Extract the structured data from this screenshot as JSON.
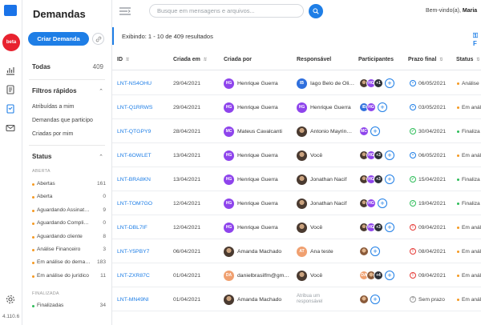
{
  "app": {
    "version": "4.110.6",
    "workspace_badge": "beta"
  },
  "sidebar": {
    "title": "Demandas",
    "create_button": "Criar Demanda",
    "all": {
      "label": "Todas",
      "count": "409"
    },
    "quick_filters": {
      "title": "Filtros rápidos",
      "items": [
        "Atribuídas a mim",
        "Demandas que participo",
        "Criadas por mim"
      ]
    },
    "status": {
      "title": "Status",
      "group_open": "ABERTA",
      "open_items": [
        {
          "label": "Abertas",
          "count": "161",
          "color": "#f59a23"
        },
        {
          "label": "Aberta",
          "count": "0",
          "color": "#f59a23"
        },
        {
          "label": "Aguardando Assinat…",
          "count": "9",
          "color": "#f59a23"
        },
        {
          "label": "Aguardando Compli…",
          "count": "0",
          "color": "#f59a23"
        },
        {
          "label": "Aguardando cliente",
          "count": "8",
          "color": "#f59a23"
        },
        {
          "label": "Análise Financeiro",
          "count": "3",
          "color": "#f59a23"
        },
        {
          "label": "Em análise do dema…",
          "count": "183",
          "color": "#f59a23"
        },
        {
          "label": "Em análise do jurídico",
          "count": "11",
          "color": "#f59a23"
        }
      ],
      "group_closed": "FINALIZADA",
      "closed_items": [
        {
          "label": "Finalizadas",
          "count": "34",
          "color": "#2ebd59"
        }
      ]
    }
  },
  "topbar": {
    "search_placeholder": "Busque em mensagens e arquivos...",
    "welcome_prefix": "Bem-vindo(a), ",
    "user_name": "Maria"
  },
  "results": {
    "text": "Exibindo: 1 - 10 de 409 resultados",
    "filter_label": "F"
  },
  "table": {
    "headers": {
      "id": "ID",
      "created_at": "Criada em",
      "created_by": "Criada por",
      "responsible": "Responsável",
      "participants": "Participantes",
      "deadline": "Prazo final",
      "status": "Status"
    },
    "rows": [
      {
        "id": "LNT-NS4OHU",
        "created": "29/04/2021",
        "by": {
          "initials": "HG",
          "name": "Henrique Guerra",
          "color": "#8e44ec"
        },
        "resp": {
          "initials": "IB",
          "name": "Iago Belo de Oli…",
          "color": "#2f6fdd"
        },
        "parts": [
          {
            "t": "photo"
          },
          {
            "t": "ini",
            "initials": "HG",
            "color": "#8e44ec"
          }
        ],
        "more": "+1",
        "deadline": {
          "text": "06/05/2021",
          "kind": "clock"
        },
        "status": {
          "text": "Análise",
          "color": "#f59a23"
        }
      },
      {
        "id": "LNT-Q1RRWS",
        "created": "29/04/2021",
        "by": {
          "initials": "HG",
          "name": "Henrique Guerra",
          "color": "#8e44ec"
        },
        "resp": {
          "initials": "HG",
          "name": "Henrique Guerra",
          "color": "#8e44ec"
        },
        "parts": [
          {
            "t": "ini",
            "initials": "IB",
            "color": "#2f6fdd"
          },
          {
            "t": "ini",
            "initials": "HG",
            "color": "#8e44ec"
          }
        ],
        "more": "",
        "deadline": {
          "text": "03/05/2021",
          "kind": "clock"
        },
        "status": {
          "text": "Em análi",
          "color": "#f59a23"
        }
      },
      {
        "id": "LNT-QTGPY9",
        "created": "28/04/2021",
        "by": {
          "initials": "MC",
          "name": "Mateus Cavalcanti",
          "color": "#8e44ec"
        },
        "resp": {
          "initials": "",
          "name": "Antonio Mayrin…",
          "color": "",
          "photo": true
        },
        "parts": [
          {
            "t": "ini",
            "initials": "MC",
            "color": "#8e44ec"
          }
        ],
        "more": "",
        "deadline": {
          "text": "30/04/2021",
          "kind": "check"
        },
        "status": {
          "text": "Finaliza",
          "color": "#2ebd59"
        }
      },
      {
        "id": "LNT-6OWLET",
        "created": "13/04/2021",
        "by": {
          "initials": "HG",
          "name": "Henrique Guerra",
          "color": "#8e44ec"
        },
        "resp": {
          "initials": "",
          "name": "Você",
          "color": "",
          "photo": true
        },
        "parts": [
          {
            "t": "photo"
          },
          {
            "t": "ini",
            "initials": "HG",
            "color": "#8e44ec"
          }
        ],
        "more": "+3",
        "deadline": {
          "text": "06/05/2021",
          "kind": "clock"
        },
        "status": {
          "text": "Em análi",
          "color": "#f59a23"
        }
      },
      {
        "id": "LNT-BRA8KN",
        "created": "13/04/2021",
        "by": {
          "initials": "HG",
          "name": "Henrique Guerra",
          "color": "#8e44ec"
        },
        "resp": {
          "initials": "",
          "name": "Jonathan Nacif",
          "color": "",
          "photo": true
        },
        "parts": [
          {
            "t": "photo"
          },
          {
            "t": "ini",
            "initials": "HG",
            "color": "#8e44ec"
          }
        ],
        "more": "+3",
        "deadline": {
          "text": "15/04/2021",
          "kind": "check"
        },
        "status": {
          "text": "Finaliza",
          "color": "#2ebd59"
        }
      },
      {
        "id": "LNT-TOM7GO",
        "created": "12/04/2021",
        "by": {
          "initials": "HG",
          "name": "Henrique Guerra",
          "color": "#8e44ec"
        },
        "resp": {
          "initials": "",
          "name": "Jonathan Nacif",
          "color": "",
          "photo": true
        },
        "parts": [
          {
            "t": "photo"
          },
          {
            "t": "ini",
            "initials": "HG",
            "color": "#8e44ec"
          }
        ],
        "more": "",
        "deadline": {
          "text": "19/04/2021",
          "kind": "check"
        },
        "status": {
          "text": "Finaliza",
          "color": "#2ebd59"
        }
      },
      {
        "id": "LNT-DBL7IF",
        "created": "12/04/2021",
        "by": {
          "initials": "HG",
          "name": "Henrique Guerra",
          "color": "#8e44ec"
        },
        "resp": {
          "initials": "",
          "name": "Você",
          "color": "",
          "photo": true
        },
        "parts": [
          {
            "t": "photo"
          },
          {
            "t": "ini",
            "initials": "HG",
            "color": "#8e44ec"
          }
        ],
        "more": "+3",
        "deadline": {
          "text": "09/04/2021",
          "kind": "warn"
        },
        "status": {
          "text": "Em análi",
          "color": "#f59a23"
        }
      },
      {
        "id": "LNT-Y5PBY7",
        "created": "06/04/2021",
        "by": {
          "initials": "",
          "name": "Amanda Machado",
          "color": "",
          "photo": true
        },
        "resp": {
          "initials": "AT",
          "name": "Ana teste",
          "color": "#f0a070"
        },
        "parts": [
          {
            "t": "amanda"
          }
        ],
        "more": "",
        "deadline": {
          "text": "08/04/2021",
          "kind": "warn"
        },
        "status": {
          "text": "Em análi",
          "color": "#f59a23"
        }
      },
      {
        "id": "LNT-ZXR87C",
        "created": "01/04/2021",
        "by": {
          "initials": "DA",
          "name": "danielbrasilfm@gm…",
          "color": "#f0a070"
        },
        "resp": {
          "initials": "",
          "name": "Você",
          "color": "",
          "photo": true
        },
        "parts": [
          {
            "t": "ini",
            "initials": "DA",
            "color": "#f0a070"
          },
          {
            "t": "amanda"
          }
        ],
        "more": "+4",
        "deadline": {
          "text": "09/04/2021",
          "kind": "warn"
        },
        "status": {
          "text": "Em análi",
          "color": "#f59a23"
        }
      },
      {
        "id": "LNT-MN49NI",
        "created": "01/04/2021",
        "by": {
          "initials": "",
          "name": "Amanda Machado",
          "color": "",
          "photo": true
        },
        "resp": {
          "initials": "",
          "name": "Atribua um responsável",
          "color": "",
          "placeholder": true
        },
        "parts": [
          {
            "t": "amanda"
          }
        ],
        "more": "",
        "deadline": {
          "text": "Sem prazo",
          "kind": "none"
        },
        "status": {
          "text": "Em análi",
          "color": "#f59a23"
        }
      }
    ]
  }
}
